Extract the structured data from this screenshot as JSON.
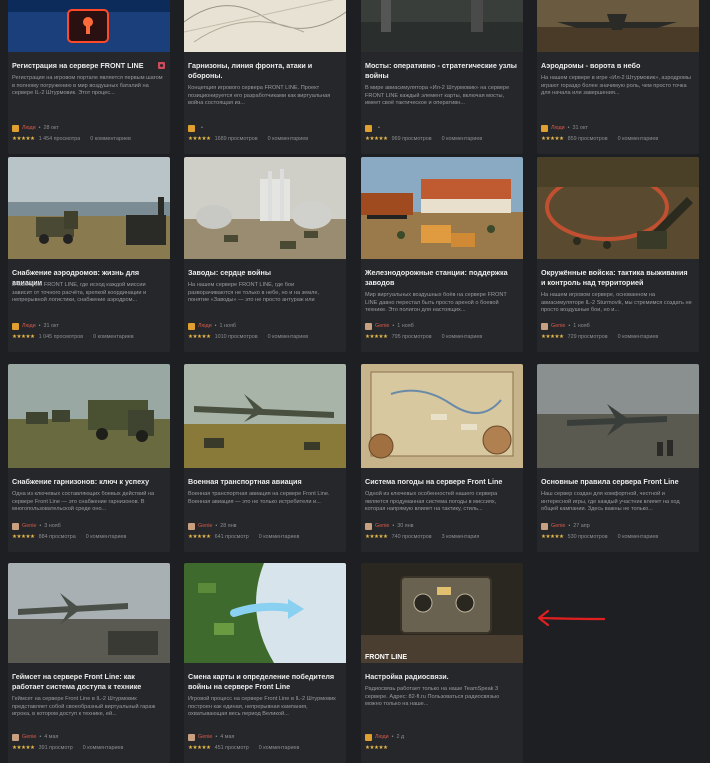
{
  "cards": [
    {
      "title": "Регистрация на сервере FRONT LINE",
      "desc": "Регистрация на игровом портале является первым шагом в полному погружению в мир воздушных баталий на сервере IL-2 Штурмовик. Этот процес...",
      "author": "Люди",
      "date": "28 окт",
      "views": "1 454 просмотра",
      "comments": "0 комментариев"
    },
    {
      "title": "Гарнизоны, линия фронта, атаки и обороны.",
      "desc": "Концепция игрового сервера FRONT LINE. Проект позиционируется его разработчиками как виртуальная война состоящая из...",
      "author": "",
      "date": "",
      "views": "1689 просмотров",
      "comments": "0 комментариев"
    },
    {
      "title": "Мосты: оперативно - стратегические узлы войны",
      "desc": "В мире авиасимулятора «Ил-2 Штурмовик» на сервере FRONT LINE каждый элемент карты, включая мосты, имеет своё тактическое и оперативн...",
      "author": "",
      "date": "",
      "views": "969 просмотров",
      "comments": "0 комментариев"
    },
    {
      "title": "Аэродромы - ворота в небо",
      "desc": "На нашем сервере в игре «Ил-2 Штурмовик», аэродромы играют гораздо более значимую роль, чем просто точка для начала или завершения...",
      "author": "Люди",
      "date": "31 окт",
      "views": "859 просмотров",
      "comments": "0 комментариев"
    },
    {
      "title": "Снабжение аэродромов: жизнь для авиации",
      "desc": "В кампании FRONT LINE, где исход каждой миссии зависит от точного расчёта, крепкой координации и непрерывной логистики, снабжение аэродром...",
      "author": "Люди",
      "date": "31 окт",
      "views": "1 045 просмотров",
      "comments": "0 комментариев"
    },
    {
      "title": "Заводы: сердце войны",
      "desc": "На нашем сервере FRONT LINE, где бои разворачиваются не только в небе, но и на земле, понятие «Заводы» — это не просто антураж или декорация. Это...",
      "author": "Люди",
      "date": "1 нояб",
      "views": "1010 просмотров",
      "comments": "0 комментариев"
    },
    {
      "title": "Железнодорожные станции: поддержка заводов",
      "desc": "Мир виртуальных воздушных боёв на сервере FRONT LINE давно перестал быть просто ареной о боевой технике. Это полигон для настоящих...",
      "author": "Genie",
      "date": "1 нояб",
      "views": "795 просмотров",
      "comments": "0 комментариев"
    },
    {
      "title": "Окружённые войска: тактика выживания и контроль над территорией",
      "desc": "На нашем игровом сервере, основанном на авиасимуляторе IL-2 Sturmovik, мы стремимся создать не просто воздушные бои, но и...",
      "author": "Genie",
      "date": "1 нояб",
      "views": "729 просмотров",
      "comments": "0 комментариев"
    },
    {
      "title": "Снабжение гарнизонов: ключ к успеху",
      "desc": "Одна из ключевых составляющих боевых действий на сервере Front Line — это снабжение гарнизонов. В многопользовательской среде оно...",
      "author": "Genie",
      "date": "3 нояб",
      "views": "884 просмотра",
      "comments": "0 комментариев"
    },
    {
      "title": "Военная транспортная авиация",
      "desc": "Военная транспортная авиация на сервере Front Line. Военная авиация — это не только истребители и...",
      "author": "Genie",
      "date": "28 янв",
      "views": "641 просмотр",
      "comments": "0 комментариев"
    },
    {
      "title": "Система погоды на сервере Front Line",
      "desc": "Одной из ключевых особенностей нашего сервера является продуманная система погоды в миссиях, которая напрямую влияет на тактику, стиль...",
      "author": "Genie",
      "date": "30 янв",
      "views": "740 просмотров",
      "comments": "3 комментария"
    },
    {
      "title": "Основные правила сервера Front Line",
      "desc": "Наш сервер создан для комфортной, честной и интересной игры, где каждый участник влияет на ход общей кампании. Здесь важны не только...",
      "author": "Genie",
      "date": "27 апр",
      "views": "530 просмотров",
      "comments": "0 комментариев"
    },
    {
      "title": "Геймсет на сервере Front Line: как работает система доступа к технике",
      "desc": "Геймсет на сервере Front Line в IL-2 Штурмовик представляет собой своеобразный виртуальный гараж игрока, в котором доступ к технике, ей...",
      "author": "Genie",
      "date": "4 мая",
      "views": "391 просмотр",
      "comments": "0 комментариев"
    },
    {
      "title": "Смена карты и определение победителя войны на сервере Front Line",
      "desc": "Игровой процесс на сервере Front Line в IL-2 Штурмовик построен как единая, непрерывная кампания, охватывающая весь период Великой...",
      "author": "Genie",
      "date": "4 мая",
      "views": "451 просмотр",
      "comments": "0 комментариев"
    },
    {
      "title": "Настройка радиосвязи.",
      "desc": "Радиосвязь работает только на наше TeamSpeak 3 сервере. Адрес: 82-fl.ru Пользоваться радиосвязью можно только на наше...",
      "author": "Люди",
      "date": "2 д",
      "views": "",
      "comments": ""
    }
  ],
  "thumb_caption": "FRONT LINE",
  "colors": {
    "background": "#1e1f22",
    "card": "#26272b",
    "author": "#d65a4a",
    "stars": "#e6b84a",
    "pin": "#d14a5c",
    "arrow": "#e02020"
  }
}
